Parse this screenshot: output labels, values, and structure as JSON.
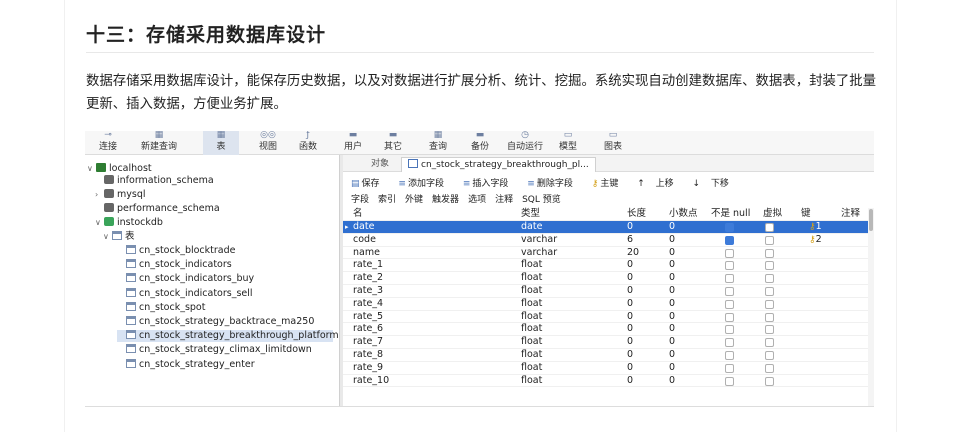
{
  "heading": "十三：存储采用数据库设计",
  "paragraph": "数据存储采用数据库设计，能保存历史数据，以及对数据进行扩展分析、统计、挖掘。系统实现自动创建数据库、数据表，封装了批量更新、插入数据，方便业务扩展。",
  "toolbar": [
    {
      "name": "connect",
      "label": "连接",
      "icon": "plug-icon"
    },
    {
      "name": "new-query",
      "label": "新建查询",
      "icon": "query-icon"
    },
    {
      "name": "table",
      "label": "表",
      "icon": "table-icon",
      "selected": true
    },
    {
      "name": "view",
      "label": "视图",
      "icon": "view-icon"
    },
    {
      "name": "function",
      "label": "函数",
      "icon": "function-icon"
    },
    {
      "name": "user",
      "label": "用户",
      "icon": "user-icon"
    },
    {
      "name": "other",
      "label": "其它",
      "icon": "other-icon"
    },
    {
      "name": "query",
      "label": "查询",
      "icon": "grid-icon"
    },
    {
      "name": "backup",
      "label": "备份",
      "icon": "backup-icon"
    },
    {
      "name": "automation",
      "label": "自动运行",
      "icon": "clock-icon"
    },
    {
      "name": "model",
      "label": "模型",
      "icon": "model-icon"
    },
    {
      "name": "chart",
      "label": "图表",
      "icon": "chart-icon"
    }
  ],
  "tree": {
    "host": "localhost",
    "databases": [
      "information_schema",
      "mysql",
      "performance_schema",
      "instockdb"
    ],
    "tables_folder": "表",
    "tables": [
      "cn_stock_blocktrade",
      "cn_stock_indicators",
      "cn_stock_indicators_buy",
      "cn_stock_indicators_sell",
      "cn_stock_spot",
      "cn_stock_strategy_backtrace_ma250",
      "cn_stock_strategy_breakthrough_platform",
      "cn_stock_strategy_climax_limitdown",
      "cn_stock_strategy_enter"
    ],
    "selected_table": "cn_stock_strategy_breakthrough_platform"
  },
  "tabs": {
    "objects": "对象",
    "active": "cn_stock_strategy_breakthrough_pl..."
  },
  "actions": {
    "save": "保存",
    "add_field": "添加字段",
    "insert_field": "插入字段",
    "delete_field": "删除字段",
    "primary_key": "主键",
    "move_up": "上移",
    "move_down": "下移"
  },
  "subtabs": [
    "字段",
    "索引",
    "外键",
    "触发器",
    "选项",
    "注释",
    "SQL 预览"
  ],
  "columns": {
    "name": "名",
    "type": "类型",
    "length": "长度",
    "decimals": "小数点",
    "not_null": "不是 null",
    "virtual": "虚拟",
    "key": "键",
    "comment": "注释"
  },
  "fields": [
    {
      "name": "date",
      "type": "date",
      "length": "0",
      "decimals": "0",
      "not_null": true,
      "virtual": false,
      "key": "1"
    },
    {
      "name": "code",
      "type": "varchar",
      "length": "6",
      "decimals": "0",
      "not_null": true,
      "virtual": false,
      "key": "2"
    },
    {
      "name": "name",
      "type": "varchar",
      "length": "20",
      "decimals": "0",
      "not_null": false,
      "virtual": false,
      "key": ""
    },
    {
      "name": "rate_1",
      "type": "float",
      "length": "0",
      "decimals": "0",
      "not_null": false,
      "virtual": false,
      "key": ""
    },
    {
      "name": "rate_2",
      "type": "float",
      "length": "0",
      "decimals": "0",
      "not_null": false,
      "virtual": false,
      "key": ""
    },
    {
      "name": "rate_3",
      "type": "float",
      "length": "0",
      "decimals": "0",
      "not_null": false,
      "virtual": false,
      "key": ""
    },
    {
      "name": "rate_4",
      "type": "float",
      "length": "0",
      "decimals": "0",
      "not_null": false,
      "virtual": false,
      "key": ""
    },
    {
      "name": "rate_5",
      "type": "float",
      "length": "0",
      "decimals": "0",
      "not_null": false,
      "virtual": false,
      "key": ""
    },
    {
      "name": "rate_6",
      "type": "float",
      "length": "0",
      "decimals": "0",
      "not_null": false,
      "virtual": false,
      "key": ""
    },
    {
      "name": "rate_7",
      "type": "float",
      "length": "0",
      "decimals": "0",
      "not_null": false,
      "virtual": false,
      "key": ""
    },
    {
      "name": "rate_8",
      "type": "float",
      "length": "0",
      "decimals": "0",
      "not_null": false,
      "virtual": false,
      "key": ""
    },
    {
      "name": "rate_9",
      "type": "float",
      "length": "0",
      "decimals": "0",
      "not_null": false,
      "virtual": false,
      "key": ""
    },
    {
      "name": "rate_10",
      "type": "float",
      "length": "0",
      "decimals": "0",
      "not_null": false,
      "virtual": false,
      "key": ""
    }
  ],
  "selected_field": "date"
}
